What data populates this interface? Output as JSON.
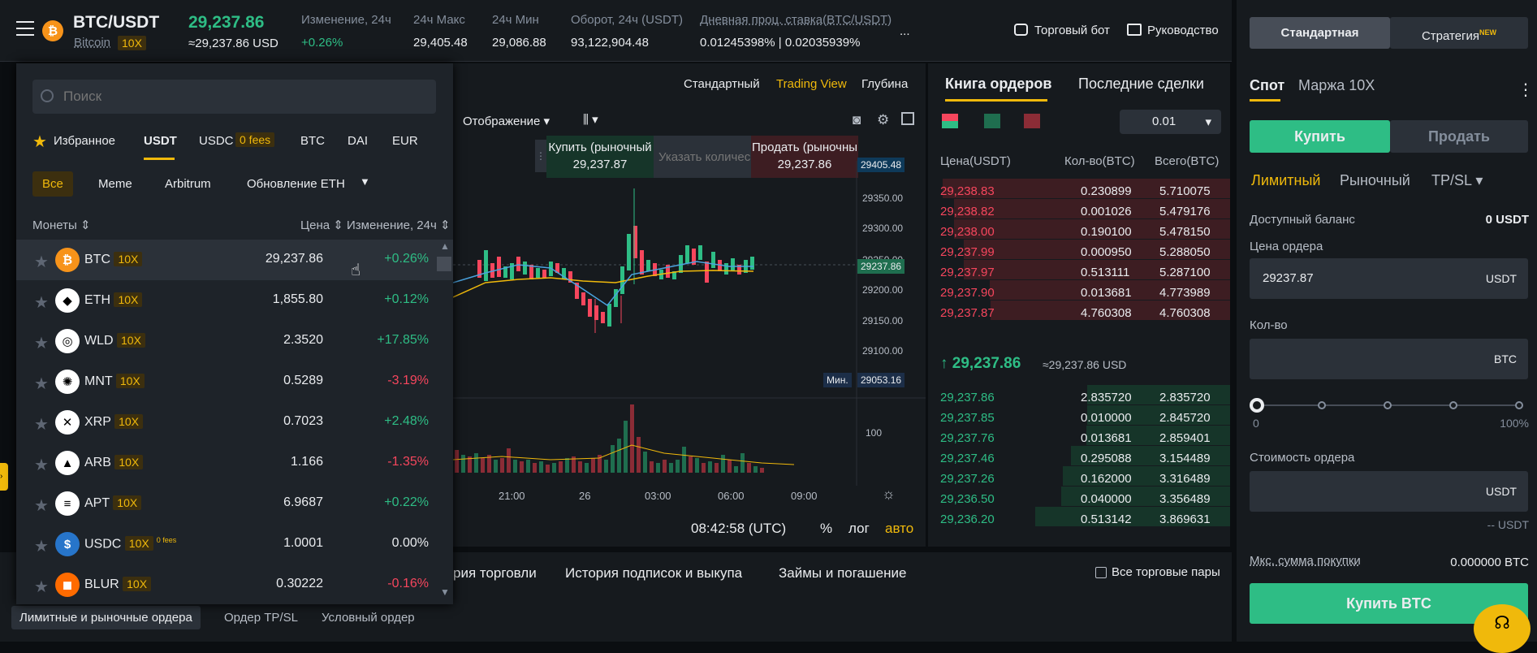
{
  "header": {
    "pair": "BTC/USDT",
    "coin": "Bitcoin",
    "leverage": "10X",
    "last_price": "29,237.86",
    "last_price_usd": "≈29,237.86 USD",
    "stats": [
      {
        "label": "Изменение, 24ч",
        "value": "+0.26%"
      },
      {
        "label": "24ч Макс",
        "value": "29,405.48"
      },
      {
        "label": "24ч Мин",
        "value": "29,086.88"
      },
      {
        "label": "Оборот, 24ч (USDT)",
        "value": "93,122,904.48"
      },
      {
        "label": "Дневная проц. ставка(BTC/USDT)",
        "value": "0.01245398% | 0.02035939%"
      }
    ],
    "more": "...",
    "bot": "Торговый бот",
    "guide": "Руководство"
  },
  "selector": {
    "search_placeholder": "Поиск",
    "tabs": [
      "Избранное",
      "USDT",
      "USDC",
      "BTC",
      "DAI",
      "EUR"
    ],
    "fees_badge": "0 fees",
    "filters": [
      "Все",
      "Meme",
      "Arbitrum",
      "Обновление ETH"
    ],
    "columns": {
      "coin": "Монеты",
      "price": "Цена",
      "change": "Изменение, 24ч"
    },
    "rows": [
      {
        "sym": "BTC",
        "lev": "10X",
        "price": "29,237.86",
        "chg": "+0.26%",
        "up": true,
        "color": "#f7931a",
        "glyph": "₿"
      },
      {
        "sym": "ETH",
        "lev": "10X",
        "price": "1,855.80",
        "chg": "+0.12%",
        "up": true,
        "color": "#ffffff",
        "glyph": "◆"
      },
      {
        "sym": "WLD",
        "lev": "10X",
        "price": "2.3520",
        "chg": "+17.85%",
        "up": true,
        "color": "#ffffff",
        "glyph": "◎"
      },
      {
        "sym": "MNT",
        "lev": "10X",
        "price": "0.5289",
        "chg": "-3.19%",
        "up": false,
        "color": "#ffffff",
        "glyph": "✺"
      },
      {
        "sym": "XRP",
        "lev": "10X",
        "price": "0.7023",
        "chg": "+2.48%",
        "up": true,
        "color": "#ffffff",
        "glyph": "✕"
      },
      {
        "sym": "ARB",
        "lev": "10X",
        "price": "1.166",
        "chg": "-1.35%",
        "up": false,
        "color": "#ffffff",
        "glyph": "▲"
      },
      {
        "sym": "APT",
        "lev": "10X",
        "price": "6.9687",
        "chg": "+0.22%",
        "up": true,
        "color": "#ffffff",
        "glyph": "≡"
      },
      {
        "sym": "USDC",
        "lev": "10X",
        "price": "1.0001",
        "chg": "0.00%",
        "up": null,
        "color": "#2775ca",
        "glyph": "$",
        "note": "0 fees"
      },
      {
        "sym": "BLUR",
        "lev": "10X",
        "price": "0.30222",
        "chg": "-0.16%",
        "up": false,
        "color": "#ff6b00",
        "glyph": "◼"
      }
    ]
  },
  "chart": {
    "views": [
      "Стандартный",
      "Trading View",
      "Глубина"
    ],
    "display": "Отображение",
    "buy_label": "Купить (рыночный",
    "buy_price": "29,237.87",
    "qty_placeholder": "Указать количес",
    "sell_label": "Продать (рыночны",
    "sell_price": "29,237.86",
    "y_ticks": [
      "29350.00",
      "29300.00",
      "29250.00",
      "29200.00",
      "29150.00",
      "29100.00"
    ],
    "high_tag": "29405.48",
    "cur_tag": "29237.86",
    "min_label": "Мин.",
    "min_tag": "29053.16",
    "vol_tick": "100",
    "x_ticks": [
      "21:00",
      "26",
      "03:00",
      "06:00",
      "09:00"
    ],
    "clock": "08:42:58 (UTC)",
    "pct": "%",
    "log": "лог",
    "auto": "авто"
  },
  "orderbook": {
    "tabs": [
      "Книга ордеров",
      "Последние сделки"
    ],
    "step": "0.01",
    "cols": [
      "Цена(USDT)",
      "Кол-во(BTC)",
      "Всего(BTC)"
    ],
    "asks": [
      [
        "29,238.83",
        "0.230899",
        "5.710075"
      ],
      [
        "29,238.82",
        "0.001026",
        "5.479176"
      ],
      [
        "29,238.00",
        "0.190100",
        "5.478150"
      ],
      [
        "29,237.99",
        "0.000950",
        "5.288050"
      ],
      [
        "29,237.97",
        "0.513111",
        "5.287100"
      ],
      [
        "29,237.90",
        "0.013681",
        "4.773989"
      ],
      [
        "29,237.87",
        "4.760308",
        "4.760308"
      ]
    ],
    "mid": "↑ 29,237.86",
    "mid_usd": "≈29,237.86 USD",
    "bids": [
      [
        "29,237.86",
        "2.835720",
        "2.835720"
      ],
      [
        "29,237.85",
        "0.010000",
        "2.845720"
      ],
      [
        "29,237.76",
        "0.013681",
        "2.859401"
      ],
      [
        "29,237.46",
        "0.295088",
        "3.154489"
      ],
      [
        "29,237.26",
        "0.162000",
        "3.316489"
      ],
      [
        "29,236.50",
        "0.040000",
        "3.356489"
      ],
      [
        "29,236.20",
        "0.513142",
        "3.869631"
      ]
    ]
  },
  "bottom": {
    "tabs": [
      "рия торговли",
      "История подписок и выкупа",
      "Займы и погашение"
    ],
    "all_pairs": "Все торговые пары",
    "subtabs": [
      "Лимитные и рыночные ордера",
      "Ордер TP/SL",
      "Условный ордер"
    ]
  },
  "trade": {
    "modes": [
      "Стандартная",
      "Стратегия"
    ],
    "new_badge": "NEW",
    "types": [
      "Спот",
      "Маржа 10X"
    ],
    "buy": "Купить",
    "sell": "Продать",
    "order_types": [
      "Лимитный",
      "Рыночный",
      "TP/SL"
    ],
    "balance_label": "Доступный баланс",
    "balance": "0 USDT",
    "price_label": "Цена ордера",
    "price_value": "29237.87",
    "price_unit": "USDT",
    "qty_label": "Кол-во",
    "qty_unit": "BTC",
    "slider_min": "0",
    "slider_max": "100%",
    "cost_label": "Стоимость ордера",
    "cost_unit": "USDT",
    "cost_hint": "-- USDT",
    "max_label": "Мкс. сумма покупки",
    "max_value": "0.000000 BTC",
    "submit": "Купить BTC"
  }
}
